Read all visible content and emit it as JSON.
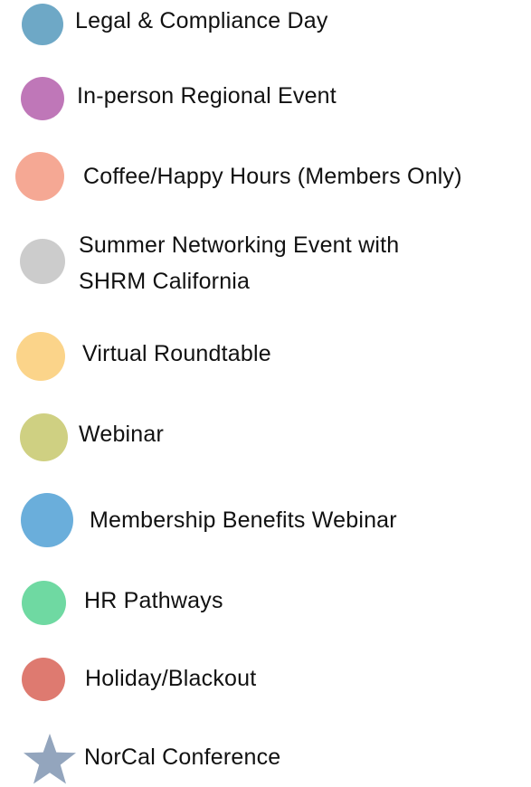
{
  "legend": {
    "items": [
      {
        "label": "Legal & Compliance Day",
        "color": "#6ea8c6",
        "icon": "circle"
      },
      {
        "label": "In-person Regional Event",
        "color": "#bf77b8",
        "icon": "circle"
      },
      {
        "label": "Coffee/Happy Hours (Members Only)",
        "color": "#f5a894",
        "icon": "circle"
      },
      {
        "label": "Summer Networking Event with",
        "label_line2": "SHRM California",
        "color": "#cccccc",
        "icon": "circle"
      },
      {
        "label": "Virtual Roundtable",
        "color": "#fbd48a",
        "icon": "circle"
      },
      {
        "label": "Webinar",
        "color": "#cfd082",
        "icon": "circle"
      },
      {
        "label": "Membership Benefits Webinar",
        "color": "#6aaedb",
        "icon": "circle"
      },
      {
        "label": "HR Pathways",
        "color": "#6fd9a2",
        "icon": "circle"
      },
      {
        "label": "Holiday/Blackout",
        "color": "#de7a70",
        "icon": "circle"
      },
      {
        "label": "NorCal Conference",
        "color": "#93a5bd",
        "icon": "star"
      }
    ]
  }
}
